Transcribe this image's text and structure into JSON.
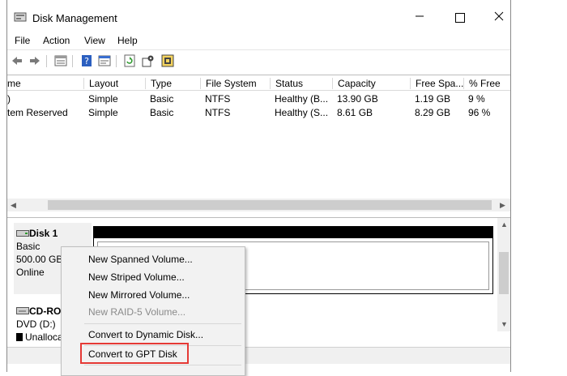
{
  "window": {
    "title": "Disk Management"
  },
  "menu": [
    "File",
    "Action",
    "View",
    "Help"
  ],
  "toolbar_icons": [
    "back-icon",
    "forward-icon",
    "list-view-icon",
    "help-icon",
    "properties-icon",
    "refresh-icon",
    "settings-icon",
    "rescan-icon"
  ],
  "volume_table": {
    "columns": [
      "me",
      "Layout",
      "Type",
      "File System",
      "Status",
      "Capacity",
      "Free Spa...",
      "% Free"
    ],
    "rows": [
      [
        ")",
        "Simple",
        "Basic",
        "NTFS",
        "Healthy (B...",
        "13.90 GB",
        "1.19 GB",
        "9 %"
      ],
      [
        "tem Reserved",
        "Simple",
        "Basic",
        "NTFS",
        "Healthy (S...",
        "8.61 GB",
        "8.29 GB",
        "96 %"
      ]
    ]
  },
  "disk1": {
    "name": "Disk 1",
    "type": "Basic",
    "size": "500.00 GB",
    "status": "Online"
  },
  "cdrom": {
    "name": "CD-RO",
    "drive": "DVD (D:)",
    "state": "Unalloca"
  },
  "context_menu": {
    "items": [
      {
        "label": "New Spanned Volume...",
        "enabled": true
      },
      {
        "label": "New Striped Volume...",
        "enabled": true
      },
      {
        "label": "New Mirrored Volume...",
        "enabled": true
      },
      {
        "label": "New RAID-5 Volume...",
        "enabled": false
      },
      {
        "label": "Convert to Dynamic Disk...",
        "enabled": true
      },
      {
        "label": "Convert to GPT Disk",
        "enabled": true
      }
    ]
  },
  "colors": {
    "highlight": "#e53935",
    "menu_bg": "#f2f2f2"
  }
}
